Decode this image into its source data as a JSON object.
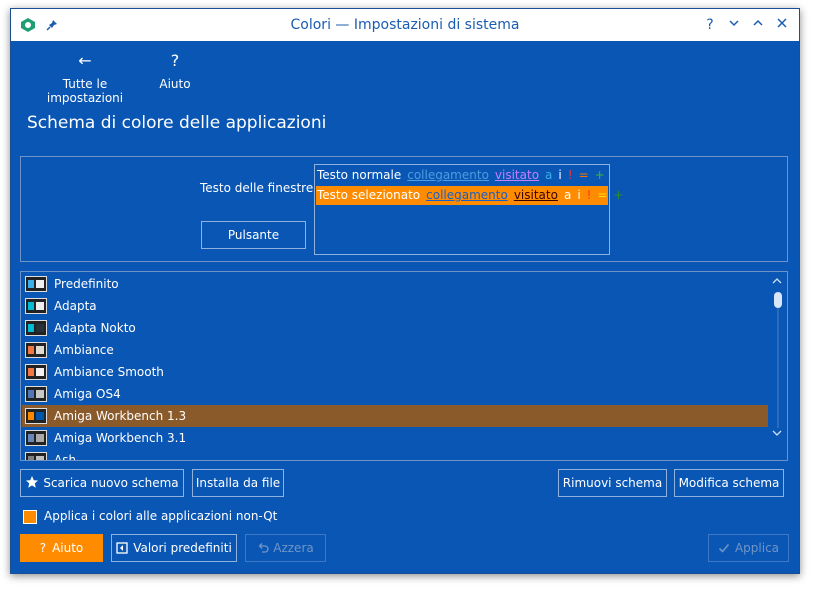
{
  "window": {
    "title": "Colori — Impostazioni di sistema",
    "icons": {
      "app": "app-icon",
      "pin": "pin-icon"
    },
    "controls": {
      "help": "?",
      "minimize": "⌄",
      "maximize": "^",
      "close": "✕"
    }
  },
  "toolbar": {
    "back_label": "Tutte le impostazioni",
    "back_icon": "←",
    "help_label": "Aiuto",
    "help_icon": "?"
  },
  "page": {
    "title": "Schema di colore delle applicazioni"
  },
  "preview": {
    "window_text_label": "Testo delle finestre",
    "button_label": "Pulsante",
    "normal_row": {
      "text": "Testo normale",
      "link": "collegamento",
      "visited": "visitato",
      "active": "a",
      "neutral": "i",
      "negative": "!",
      "neutral2": "=",
      "positive": "+"
    },
    "selected_row": {
      "text": "Testo selezionato",
      "link": "collegamento",
      "visited": "visitato",
      "active": "a",
      "neutral": "i",
      "negative": "!",
      "neutral2": "=",
      "positive": "+"
    }
  },
  "schemes": {
    "items": [
      {
        "name": "Predefinito",
        "thumb_a": "#3daee9",
        "thumb_b": "#eff0f1"
      },
      {
        "name": "Adapta",
        "thumb_a": "#00bcd4",
        "thumb_b": "#eeeeee"
      },
      {
        "name": "Adapta Nokto",
        "thumb_a": "#00bcd4",
        "thumb_b": "#263238"
      },
      {
        "name": "Ambiance",
        "thumb_a": "#f07746",
        "thumb_b": "#dfdbd2"
      },
      {
        "name": "Ambiance Smooth",
        "thumb_a": "#f07746",
        "thumb_b": "#f2f1f0"
      },
      {
        "name": "Amiga OS4",
        "thumb_a": "#5078b4",
        "thumb_b": "#c8c8c8"
      },
      {
        "name": "Amiga Workbench 1.3",
        "thumb_a": "#ff8800",
        "thumb_b": "#0055aa"
      },
      {
        "name": "Amiga Workbench 3.1",
        "thumb_a": "#6688bb",
        "thumb_b": "#aaaaaa"
      },
      {
        "name": "Ash",
        "thumb_a": "#808080",
        "thumb_b": "#c0c0c0"
      }
    ],
    "selected_index": 6
  },
  "actions": {
    "download_label": "Scarica nuovo schema",
    "install_label": "Installa da file",
    "remove_label": "Rimuovi schema",
    "edit_label": "Modifica schema"
  },
  "option": {
    "apply_non_qt_label": "Applica i colori alle applicazioni non-Qt",
    "apply_non_qt_checked": true
  },
  "footer": {
    "help_label": "Aiuto",
    "help_icon": "?",
    "defaults_label": "Valori predefiniti",
    "reset_label": "Azzera",
    "apply_label": "Applica"
  },
  "colors": {
    "window_bg": "#0a56b4",
    "accent": "#ff8c00",
    "selected_item": "#8b5a2b"
  }
}
